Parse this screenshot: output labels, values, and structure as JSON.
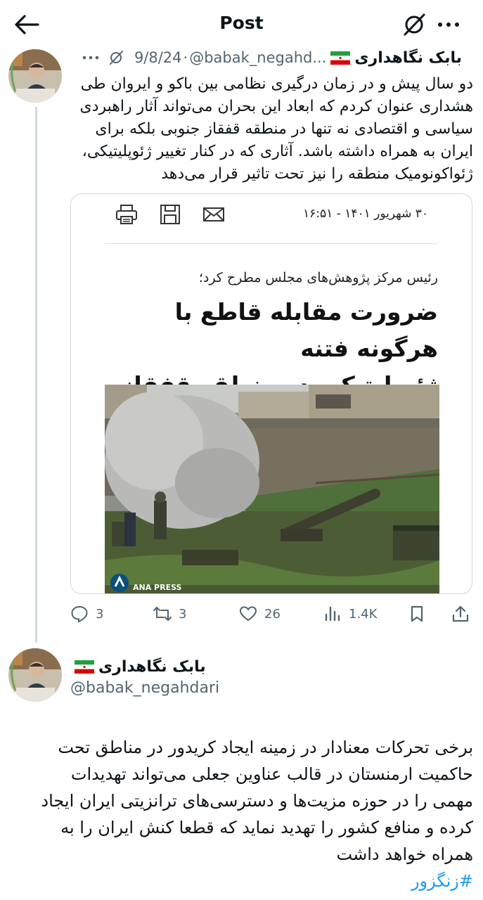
{
  "header": {
    "title": "Post",
    "back_icon": "arrow-left-icon",
    "grok_icon": "grok-icon",
    "more_icon": "more-icon"
  },
  "tweet1": {
    "display_name": "بابک نگاهداری",
    "handle": "@babak_negahd...",
    "date": "9/8/24",
    "separator": "·",
    "text_lines": [
      "دو سال پیش و در زمان درگیری نظامی بین باکو و ایروان طی",
      "هشداری عنوان کردم که ابعاد این بحران می‌تواند آثار راهبردی",
      "سیاسی و اقتصادی نه تنها در منطقه قفقاز جنوبی بلکه برای",
      "ایران به همراه داشته باشد. آثاری که در کنار تغییر ژئوپلیتیکی،",
      "ژئواکونومیک منطقه را نیز تحت تاثیر قرار می‌دهد"
    ],
    "article": {
      "date": "۳۰ شهریور ۱۴۰۱ - ۱۶:۵۱",
      "kicker": "رئیس مرکز پژوهش‌های مجلس مطرح کرد؛",
      "headline_lines": [
        "ضرورت مقابله قاطع با هرگونه فتنه",
        "ژئوپلیتیکی در منطقه قفقاز جنوبی"
      ],
      "photo_credit": "ANA PRESS"
    },
    "actions": {
      "replies": "3",
      "reposts": "3",
      "likes": "26",
      "views": "1.4K"
    }
  },
  "tweet2": {
    "display_name": "بابک نگاهداری",
    "handle": "@babak_negahdari",
    "text_lines": [
      "برخی تحرکات معنادار در زمینه ایجاد کریدور در مناطق تحت",
      "حاکمیت ارمنستان در قالب عناوین جعلی می‌تواند تهدیدات",
      "مهمی را در حوزه مزیت‌ها و دسترسی‌های ترانزیتی ایران ایجاد",
      "کرده و منافع کشور را تهدید نماید که قطعا کنش ایران را به",
      "همراه خواهد داشت"
    ],
    "hashtag": "#زنگزور"
  },
  "colors": {
    "text": "#0f1419",
    "muted": "#536471",
    "link": "#1d9bf0",
    "border": "#cfd9de"
  }
}
